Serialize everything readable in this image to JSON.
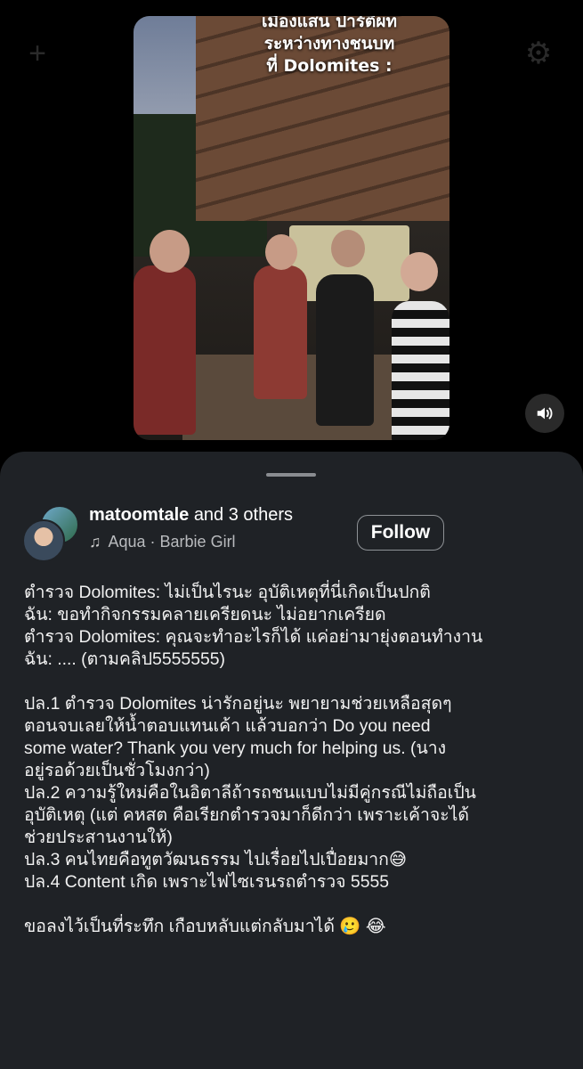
{
  "video": {
    "overlay_lines": [
      "เมืองแสน ปาร์ตี้ผท",
      "ระหว่างทางชนบท",
      "ที่ Dolomites :"
    ]
  },
  "post": {
    "username": "matoomtale",
    "collab_suffix": "and 3 others",
    "music": "Aqua · Barbie Girl",
    "follow_label": "Follow",
    "caption_lines": [
      "ตำรวจ Dolomites: ไม่เป็นไรนะ อุบัติเหตุที่นี่เกิดเป็นปกติ",
      "ฉัน: ขอทำกิจกรรมคลายเครียดนะ ไม่อยากเครียด",
      "ตำรวจ Dolomites: คุณจะทำอะไรก็ได้ แค่อย่ามายุ่งตอนทำงาน",
      "ฉัน: .... (ตามคลิป5555555)",
      "",
      "ปล.1 ตำรวจ Dolomites น่ารักอยู่นะ พยายามช่วยเหลือสุดๆ",
      "ตอนจบเลยให้น้ำตอบแทนเค้า แล้วบอกว่า Do you need",
      "some water? Thank you very much for helping us. (นาง",
      "อยู่รอด้วยเป็นชั่วโมงกว่า)",
      "ปล.2 ความรู้ใหม่คือในอิตาลีถ้ารถชนแบบไม่มีคู่กรณีไม่ถือเป็น",
      "อุบัติเหตุ (แต่ คหสต คือเรียกตำรวจมาก็ดีกว่า เพราะเค้าจะได้",
      "ช่วยประสานงานให้)",
      "ปล.3 คนไทยคือทูตวัฒนธรรม ไปเรื่อยไปเปื่อยมาก😅",
      "ปล.4 Content เกิด เพราะไฟไซเรนรถตำรวจ 5555",
      "",
      "ขอลงไว้เป็นที่ระทึก เกือบหลับแต่กลับมาได้ 🥲 😂"
    ]
  },
  "icons": {
    "mute": "speaker-icon",
    "music": "music-note-icon",
    "top_left": "plus-icon",
    "top_right": "settings-icon"
  }
}
